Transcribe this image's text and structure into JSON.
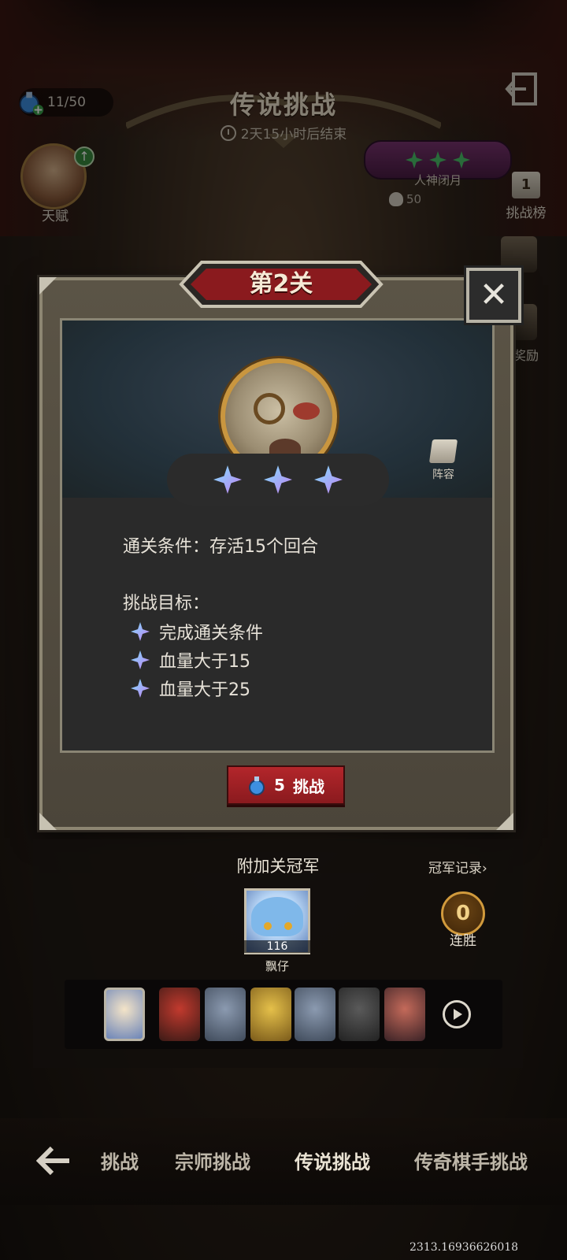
{
  "header": {
    "energy": "11/50",
    "title": "传说挑战",
    "timer": "2天15小时后结束"
  },
  "left_panel": {
    "talent_label": "天赋"
  },
  "right_panel": {
    "boss_name": "人神闭月",
    "boss_count": "50",
    "rank_number": "1",
    "rank_label": "挑战榜",
    "reward_label": "奖励"
  },
  "modal": {
    "stage_title": "第2关",
    "lineup_label": "阵容",
    "stars_earned": 3,
    "stars_total": 3,
    "condition_label": "通关条件：",
    "condition_value": "存活15个回合",
    "goals_title": "挑战目标：",
    "goals": [
      "完成通关条件",
      "血量大于15",
      "血量大于25"
    ],
    "challenge_cost": "5",
    "challenge_label": "挑战"
  },
  "champion": {
    "title": "附加关冠军",
    "record_link": "冠军记录›",
    "level": "116",
    "name": "飘仔",
    "streak": "0",
    "streak_label": "连胜"
  },
  "bottom_nav": {
    "tabs": [
      "挑战",
      "宗师挑战",
      "传说挑战",
      "传奇棋手挑战"
    ],
    "active": "传说挑战"
  },
  "footer": {
    "coord": "2313.16936626018"
  },
  "colors": {
    "accent_red": "#b3262b",
    "gold": "#c9963f",
    "panel": "#2a2a2a"
  }
}
